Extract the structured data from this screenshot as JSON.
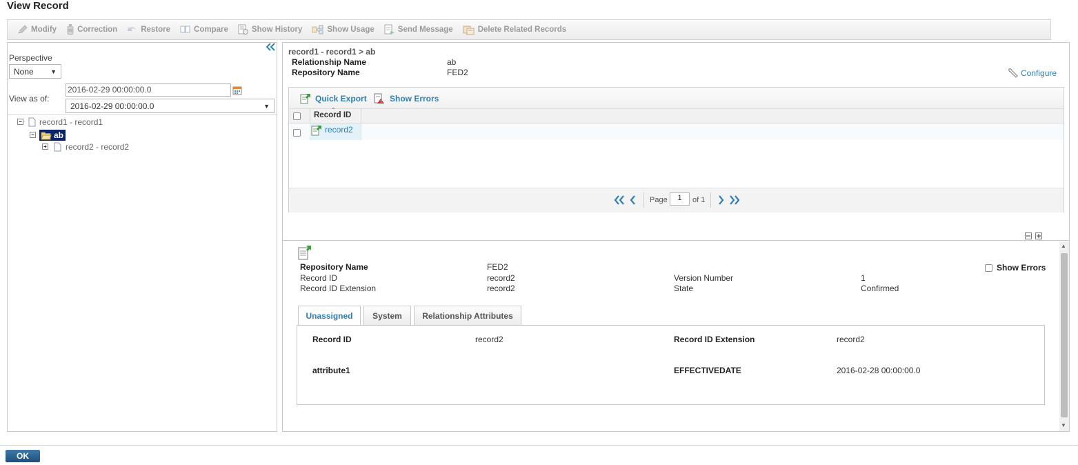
{
  "page": {
    "title": "View Record"
  },
  "toolbar": {
    "modify": "Modify",
    "correction": "Correction",
    "restore": "Restore",
    "compare": "Compare",
    "show_history": "Show History",
    "show_usage": "Show Usage",
    "send_message": "Send Message",
    "delete_related": "Delete Related Records"
  },
  "left": {
    "perspective_label": "Perspective",
    "perspective_value": "None",
    "view_as_of_label": "View as of:",
    "date_input": "2016-02-29 00:00:00.0",
    "date_select": "2016-02-29 00:00:00.0",
    "tree": {
      "root": "record1 - record1",
      "child": "ab",
      "grandchild": "record2 - record2"
    }
  },
  "right": {
    "breadcrumb": "record1 - record1 > ab",
    "relationship_name_label": "Relationship Name",
    "relationship_name_value": "ab",
    "repository_name_label": "Repository Name",
    "repository_name_value": "FED2",
    "configure": "Configure",
    "grid": {
      "quick_export": "Quick Export",
      "show_errors": "Show Errors",
      "column_record_id": "Record ID",
      "rows": [
        {
          "record_id": "record2"
        }
      ],
      "page_label": "Page",
      "page_value": "1",
      "of_label": "of 1"
    },
    "detail": {
      "repository_name_label": "Repository Name",
      "repository_name_value": "FED2",
      "record_id_label": "Record ID",
      "record_id_value": "record2",
      "record_id_ext_label": "Record ID Extension",
      "record_id_ext_value": "record2",
      "version_number_label": "Version Number",
      "version_number_value": "1",
      "state_label": "State",
      "state_value": "Confirmed",
      "show_errors": "Show Errors",
      "tabs": [
        "Unassigned",
        "System",
        "Relationship Attributes"
      ],
      "attrs": {
        "record_id_label": "Record ID",
        "record_id_value": "record2",
        "record_id_ext_label": "Record ID Extension",
        "record_id_ext_value": "record2",
        "attribute1_label": "attribute1",
        "effectivedate_label": "EFFECTIVEDATE",
        "effectivedate_value": "2016-02-28 00:00:00.0"
      }
    }
  },
  "footer": {
    "ok": "OK"
  }
}
